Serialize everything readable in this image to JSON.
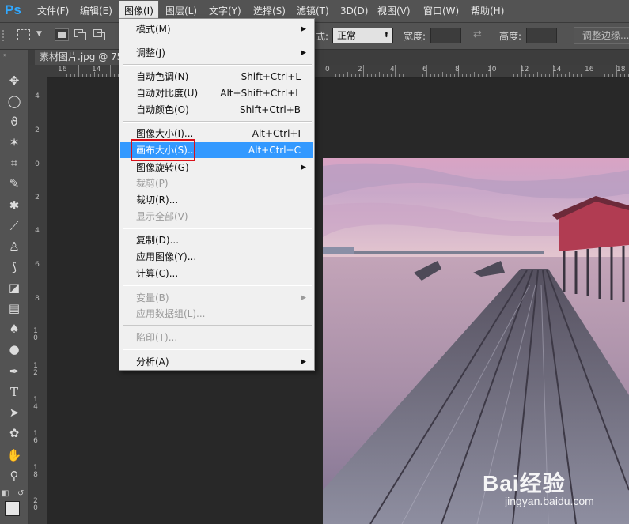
{
  "app": {
    "logo": "Ps"
  },
  "menubar": {
    "items": [
      "文件(F)",
      "编辑(E)",
      "图像(I)",
      "图层(L)",
      "文字(Y)",
      "选择(S)",
      "滤镜(T)",
      "3D(D)",
      "视图(V)",
      "窗口(W)",
      "帮助(H)"
    ]
  },
  "options": {
    "style_label_suffix": "式:",
    "style_value": "正常",
    "width_label": "宽度:",
    "height_label": "高度:",
    "refine_button": "调整边缘..."
  },
  "document": {
    "tab_title": "素材图片.jpg @ 75"
  },
  "rulers": {
    "top": [
      "16",
      "14"
    ],
    "top_right": [
      "0",
      "2",
      "4",
      "6",
      "8",
      "10",
      "12",
      "14",
      "16",
      "18"
    ],
    "left": [
      "4",
      "2",
      "0",
      "2",
      "4",
      "6",
      "8",
      "1 0",
      "1 2",
      "1 4",
      "1 6",
      "1 8",
      "2 0"
    ]
  },
  "image_menu": {
    "groups": [
      [
        {
          "label": "模式(M)",
          "submenu": true
        },
        {
          "label": "调整(J)",
          "submenu": true
        }
      ],
      [
        {
          "label": "自动色调(N)",
          "shortcut": "Shift+Ctrl+L"
        },
        {
          "label": "自动对比度(U)",
          "shortcut": "Alt+Shift+Ctrl+L"
        },
        {
          "label": "自动颜色(O)",
          "shortcut": "Shift+Ctrl+B"
        }
      ],
      [
        {
          "label": "图像大小(I)...",
          "shortcut": "Alt+Ctrl+I"
        },
        {
          "label": "画布大小(S)...",
          "shortcut": "Alt+Ctrl+C",
          "highlighted": true
        },
        {
          "label": "图像旋转(G)",
          "submenu": true
        },
        {
          "label": "裁剪(P)",
          "disabled": true
        },
        {
          "label": "裁切(R)..."
        },
        {
          "label": "显示全部(V)",
          "disabled": true
        }
      ],
      [
        {
          "label": "复制(D)..."
        },
        {
          "label": "应用图像(Y)..."
        },
        {
          "label": "计算(C)..."
        }
      ],
      [
        {
          "label": "变量(B)",
          "submenu": true,
          "disabled": true
        },
        {
          "label": "应用数据组(L)...",
          "disabled": true
        }
      ],
      [
        {
          "label": "陷印(T)...",
          "disabled": true
        }
      ],
      [
        {
          "label": "分析(A)",
          "submenu": true
        }
      ]
    ]
  },
  "watermark": {
    "brand": "Bai经验",
    "url": "jingyan.baidu.com"
  },
  "colors": {
    "accent": "#3399ff",
    "highlight_box": "#d9101a",
    "ps_logo": "#31a8ff"
  }
}
